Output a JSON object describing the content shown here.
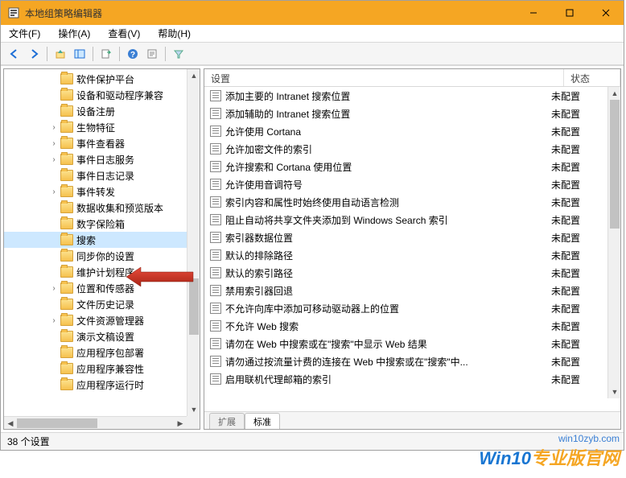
{
  "window": {
    "title": "本地组策略编辑器"
  },
  "menus": {
    "file": "文件(F)",
    "action": "操作(A)",
    "view": "查看(V)",
    "help": "帮助(H)"
  },
  "tree": {
    "items": [
      {
        "label": "软件保护平台",
        "expandable": false
      },
      {
        "label": "设备和驱动程序兼容",
        "expandable": false
      },
      {
        "label": "设备注册",
        "expandable": false
      },
      {
        "label": "生物特征",
        "expandable": true
      },
      {
        "label": "事件查看器",
        "expandable": true
      },
      {
        "label": "事件日志服务",
        "expandable": true
      },
      {
        "label": "事件日志记录",
        "expandable": false
      },
      {
        "label": "事件转发",
        "expandable": true
      },
      {
        "label": "数据收集和预览版本",
        "expandable": false
      },
      {
        "label": "数字保险箱",
        "expandable": false
      },
      {
        "label": "搜索",
        "expandable": false,
        "selected": true
      },
      {
        "label": "同步你的设置",
        "expandable": false
      },
      {
        "label": "维护计划程序",
        "expandable": false
      },
      {
        "label": "位置和传感器",
        "expandable": true
      },
      {
        "label": "文件历史记录",
        "expandable": false
      },
      {
        "label": "文件资源管理器",
        "expandable": true
      },
      {
        "label": "演示文稿设置",
        "expandable": false
      },
      {
        "label": "应用程序包部署",
        "expandable": false
      },
      {
        "label": "应用程序兼容性",
        "expandable": false
      },
      {
        "label": "应用程序运行时",
        "expandable": false
      }
    ]
  },
  "columns": {
    "setting": "设置",
    "status": "状态"
  },
  "policies": [
    {
      "name": "添加主要的 Intranet 搜索位置",
      "status": "未配置"
    },
    {
      "name": "添加辅助的 Intranet 搜索位置",
      "status": "未配置"
    },
    {
      "name": "允许使用 Cortana",
      "status": "未配置"
    },
    {
      "name": "允许加密文件的索引",
      "status": "未配置"
    },
    {
      "name": "允许搜索和 Cortana 使用位置",
      "status": "未配置"
    },
    {
      "name": "允许使用音调符号",
      "status": "未配置"
    },
    {
      "name": "索引内容和属性时始终使用自动语言检测",
      "status": "未配置"
    },
    {
      "name": "阻止自动将共享文件夹添加到 Windows Search 索引",
      "status": "未配置"
    },
    {
      "name": "索引器数据位置",
      "status": "未配置"
    },
    {
      "name": "默认的排除路径",
      "status": "未配置"
    },
    {
      "name": "默认的索引路径",
      "status": "未配置"
    },
    {
      "name": "禁用索引器回退",
      "status": "未配置"
    },
    {
      "name": "不允许向库中添加可移动驱动器上的位置",
      "status": "未配置"
    },
    {
      "name": "不允许 Web 搜索",
      "status": "未配置"
    },
    {
      "name": "请勿在 Web 中搜索或在\"搜索\"中显示 Web 结果",
      "status": "未配置"
    },
    {
      "name": "请勿通过按流量计费的连接在 Web 中搜索或在\"搜索\"中...",
      "status": "未配置"
    },
    {
      "name": "启用联机代理邮箱的索引",
      "status": "未配置"
    }
  ],
  "tabs": {
    "extended": "扩展",
    "standard": "标准"
  },
  "statusbar": {
    "text": "38 个设置"
  },
  "watermark": {
    "url": "win10zyb.com",
    "brand_a": "Win10",
    "brand_b": "专业版官网"
  }
}
